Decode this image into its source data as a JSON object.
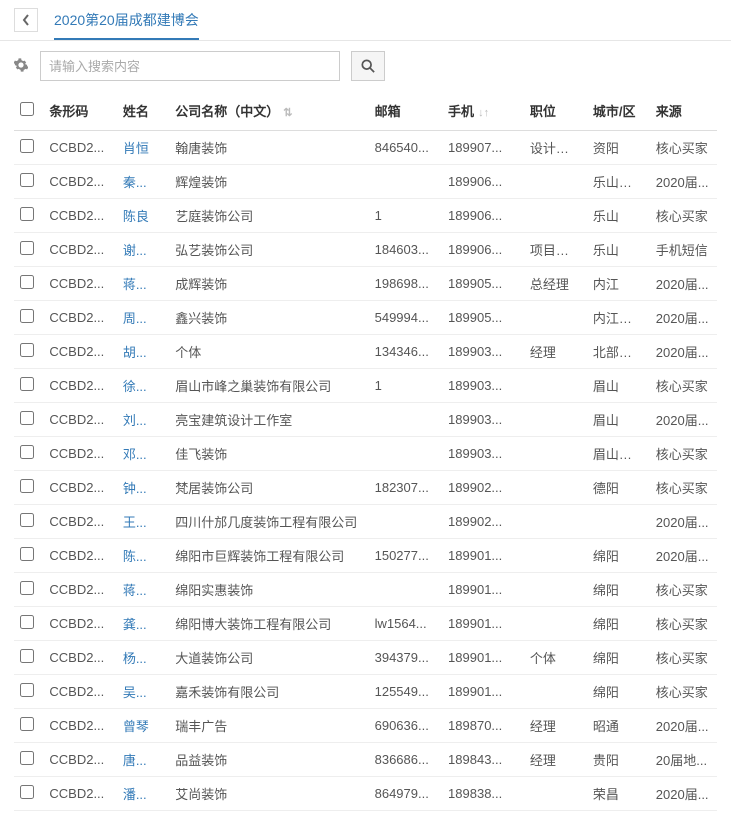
{
  "header": {
    "breadcrumb": "2020第20届成都建博会"
  },
  "search": {
    "placeholder": "请输入搜索内容"
  },
  "columns": {
    "barcode": "条形码",
    "name": "姓名",
    "company": "公司名称（中文）",
    "email": "邮箱",
    "phone": "手机",
    "position": "职位",
    "city": "城市/区",
    "source": "来源"
  },
  "rows": [
    {
      "barcode": "CCBD2...",
      "name": "肖恒",
      "company": "翰唐装饰",
      "email": "846540...",
      "phone": "189907...",
      "position": "设计总监",
      "city": "资阳",
      "source": "核心买家"
    },
    {
      "barcode": "CCBD2...",
      "name": "秦...",
      "company": "辉煌装饰",
      "email": "",
      "phone": "189906...",
      "position": "",
      "city": "乐山夹江",
      "source": "2020届..."
    },
    {
      "barcode": "CCBD2...",
      "name": "陈良",
      "company": "艺庭装饰公司",
      "email": "1",
      "phone": "189906...",
      "position": "",
      "city": "乐山",
      "source": "核心买家"
    },
    {
      "barcode": "CCBD2...",
      "name": "谢...",
      "company": "弘艺装饰公司",
      "email": "184603...",
      "phone": "189906...",
      "position": "项目经理",
      "city": "乐山",
      "source": "手机短信"
    },
    {
      "barcode": "CCBD2...",
      "name": "蒋...",
      "company": "成辉装饰",
      "email": "198698...",
      "phone": "189905...",
      "position": "总经理",
      "city": "内江",
      "source": "2020届..."
    },
    {
      "barcode": "CCBD2...",
      "name": "周...",
      "company": "鑫兴装饰",
      "email": "549994...",
      "phone": "189905...",
      "position": "",
      "city": "内江威远",
      "source": "2020届..."
    },
    {
      "barcode": "CCBD2...",
      "name": "胡...",
      "company": "个体",
      "email": "134346...",
      "phone": "189903...",
      "position": "经理",
      "city": "北部新区",
      "source": "2020届..."
    },
    {
      "barcode": "CCBD2...",
      "name": "徐...",
      "company": "眉山市峰之巢装饰有限公司",
      "email": "1",
      "phone": "189903...",
      "position": "",
      "city": "眉山",
      "source": "核心买家"
    },
    {
      "barcode": "CCBD2...",
      "name": "刘...",
      "company": "亮宝建筑设计工作室",
      "email": "",
      "phone": "189903...",
      "position": "",
      "city": "眉山",
      "source": "2020届..."
    },
    {
      "barcode": "CCBD2...",
      "name": "邓...",
      "company": "佳飞装饰",
      "email": "",
      "phone": "189903...",
      "position": "",
      "city": "眉山仁寿",
      "source": "核心买家"
    },
    {
      "barcode": "CCBD2...",
      "name": "钟...",
      "company": "梵居装饰公司",
      "email": "182307...",
      "phone": "189902...",
      "position": "",
      "city": "德阳",
      "source": "核心买家"
    },
    {
      "barcode": "CCBD2...",
      "name": "王...",
      "company": "四川什邡几度装饰工程有限公司",
      "email": "",
      "phone": "189902...",
      "position": "",
      "city": "",
      "source": "2020届..."
    },
    {
      "barcode": "CCBD2...",
      "name": "陈...",
      "company": "绵阳市巨辉装饰工程有限公司",
      "email": "150277...",
      "phone": "189901...",
      "position": "",
      "city": "绵阳",
      "source": "2020届..."
    },
    {
      "barcode": "CCBD2...",
      "name": "蒋...",
      "company": "绵阳实惠装饰",
      "email": "",
      "phone": "189901...",
      "position": "",
      "city": "绵阳",
      "source": "核心买家"
    },
    {
      "barcode": "CCBD2...",
      "name": "龚...",
      "company": "绵阳博大装饰工程有限公司",
      "email": "lw1564...",
      "phone": "189901...",
      "position": "",
      "city": "绵阳",
      "source": "核心买家"
    },
    {
      "barcode": "CCBD2...",
      "name": "杨...",
      "company": "大道装饰公司",
      "email": "394379...",
      "phone": "189901...",
      "position": "个体",
      "city": "绵阳",
      "source": "核心买家"
    },
    {
      "barcode": "CCBD2...",
      "name": "吴...",
      "company": "嘉禾装饰有限公司",
      "email": "125549...",
      "phone": "189901...",
      "position": "",
      "city": "绵阳",
      "source": "核心买家"
    },
    {
      "barcode": "CCBD2...",
      "name": "曾琴",
      "company": "瑞丰广告",
      "email": "690636...",
      "phone": "189870...",
      "position": "经理",
      "city": "昭通",
      "source": "2020届..."
    },
    {
      "barcode": "CCBD2...",
      "name": "唐...",
      "company": "品益装饰",
      "email": "836686...",
      "phone": "189843...",
      "position": "经理",
      "city": "贵阳",
      "source": "20届地..."
    },
    {
      "barcode": "CCBD2...",
      "name": "潘...",
      "company": "艾尚装饰",
      "email": "864979...",
      "phone": "189838...",
      "position": "",
      "city": "荣昌",
      "source": "2020届..."
    }
  ]
}
